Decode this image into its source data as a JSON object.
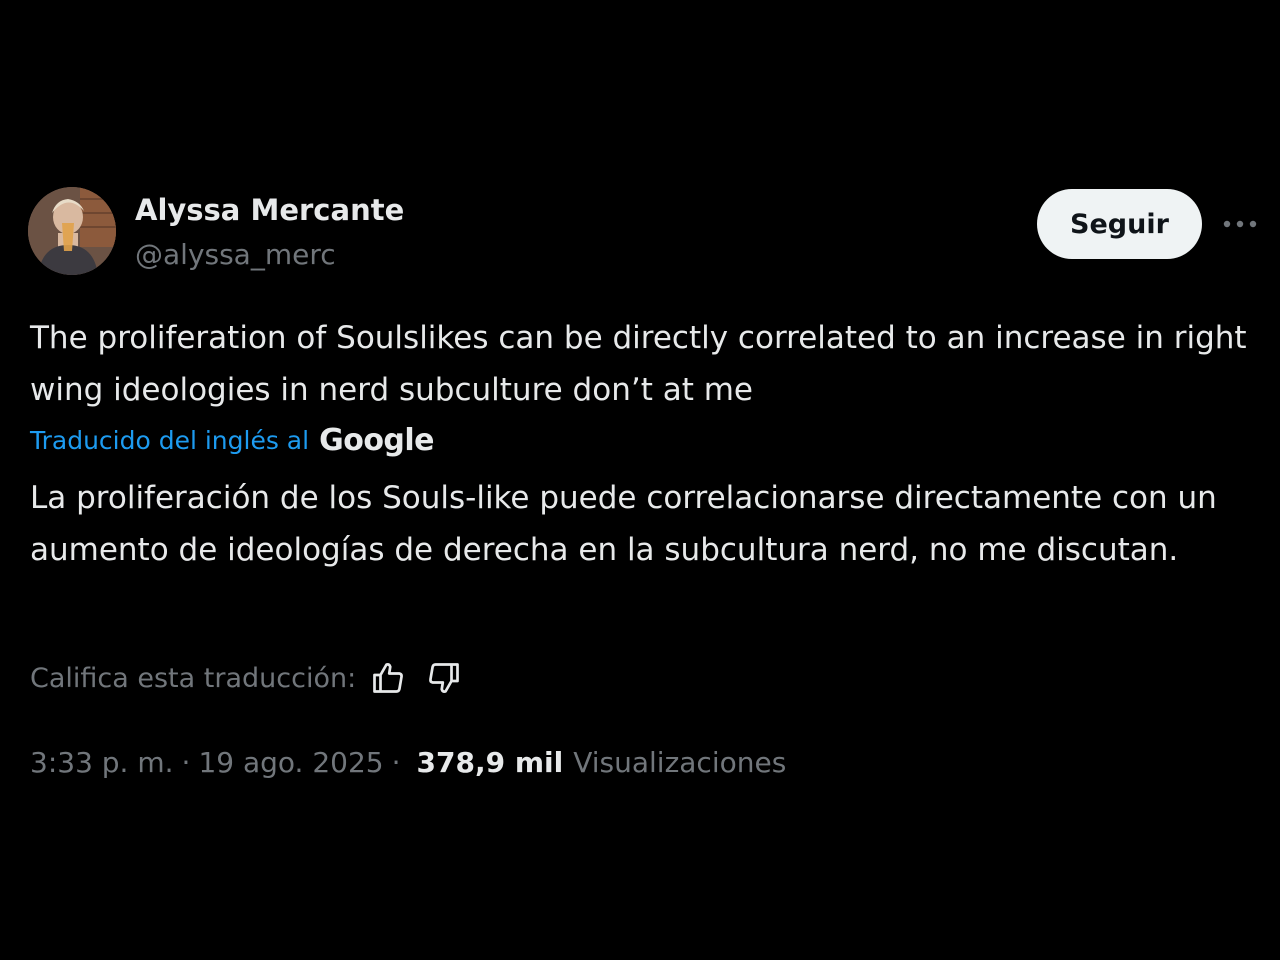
{
  "author": {
    "name": "Alyssa Mercante",
    "handle": "@alyssa_merc"
  },
  "follow_label": "Seguir",
  "more_icon": "more-horizontal-icon",
  "tweet_text": "The proliferation of Soulslikes can be directly correlated to an increase in right wing ideologies in nerd subculture don’t at me",
  "translation": {
    "label": "Traducido del inglés al",
    "provider": "Google",
    "text": "La proliferación de los Souls-like puede correlacionarse directamente con un aumento de ideologías de derecha en la subcultura nerd, no me discutan.",
    "rate_label": "Califica esta traducción:",
    "thumbs_up_icon": "thumbs-up-icon",
    "thumbs_down_icon": "thumbs-down-icon"
  },
  "meta": {
    "time": "3:33 p. m.",
    "separator": "·",
    "date": "19 ago. 2025",
    "views_count": "378,9 mil",
    "views_label": "Visualizaciones"
  },
  "colors": {
    "background": "#000000",
    "primary_text": "#e7e9ea",
    "secondary_text": "#71767b",
    "link": "#1d9bf0",
    "follow_button_bg": "#eff3f4",
    "follow_button_text": "#0f1419"
  }
}
